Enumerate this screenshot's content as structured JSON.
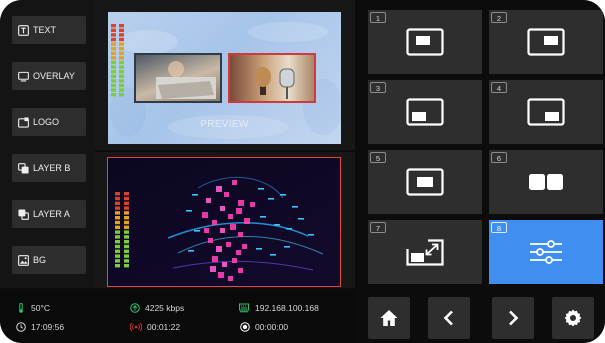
{
  "layers": [
    {
      "label": "TEXT",
      "icon": "text-icon"
    },
    {
      "label": "OVERLAY",
      "icon": "overlay-icon"
    },
    {
      "label": "LOGO",
      "icon": "logo-icon"
    },
    {
      "label": "LAYER B",
      "icon": "layer-b-icon"
    },
    {
      "label": "LAYER A",
      "icon": "layer-a-icon"
    },
    {
      "label": "BG",
      "icon": "background-image-icon"
    }
  ],
  "preview": {
    "label": "PREVIEW"
  },
  "status": {
    "temperature": "50°C",
    "bitrate": "4225 kbps",
    "ip_address": "192.168.100.168",
    "clock": "17:09:56",
    "live_duration": "00:01:22",
    "record_duration": "00:00:00"
  },
  "scenes": [
    {
      "number": "1",
      "icon": "layout-small-center-icon"
    },
    {
      "number": "2",
      "icon": "layout-small-right-icon"
    },
    {
      "number": "3",
      "icon": "layout-bottom-left-icon"
    },
    {
      "number": "4",
      "icon": "layout-bottom-right-icon"
    },
    {
      "number": "5",
      "icon": "layout-center-icon"
    },
    {
      "number": "6",
      "icon": "split-two-icon"
    },
    {
      "number": "7",
      "icon": "resize-icon"
    },
    {
      "number": "8",
      "icon": "sliders-icon",
      "active": true
    }
  ],
  "nav": {
    "home_icon": "home-icon",
    "prev_icon": "chevron-left-icon",
    "next_icon": "chevron-right-icon",
    "settings_icon": "gear-icon"
  },
  "colors": {
    "accent": "#3f8ef0",
    "program_border": "#e24444",
    "status_green": "#2fc46b",
    "status_red": "#e03030"
  }
}
